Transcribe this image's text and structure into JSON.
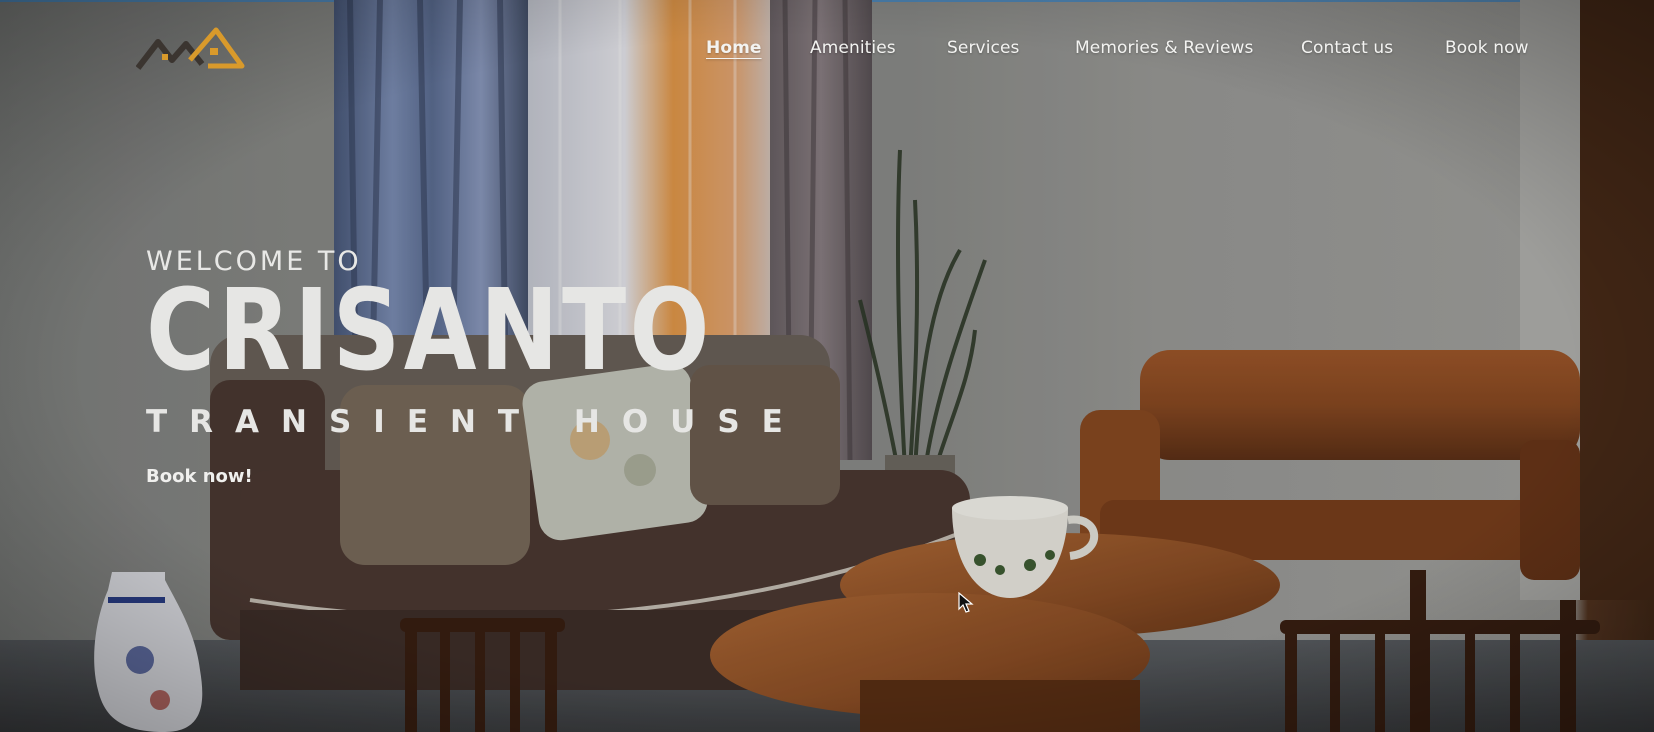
{
  "nav": {
    "items": [
      {
        "label": "Home",
        "active": true
      },
      {
        "label": "Amenities"
      },
      {
        "label": "Services"
      },
      {
        "label": "Memories & Reviews"
      },
      {
        "label": "Contact us"
      },
      {
        "label": "Book now"
      }
    ]
  },
  "hero": {
    "welcome": "WELCOME TO",
    "title": "CRISANTO",
    "subtitle": "TRANSIENT HOUSE",
    "cta": "Book now!"
  },
  "colors": {
    "logo_dark": "#3b3530",
    "logo_gold": "#d99a2b",
    "text": "#ececea"
  }
}
